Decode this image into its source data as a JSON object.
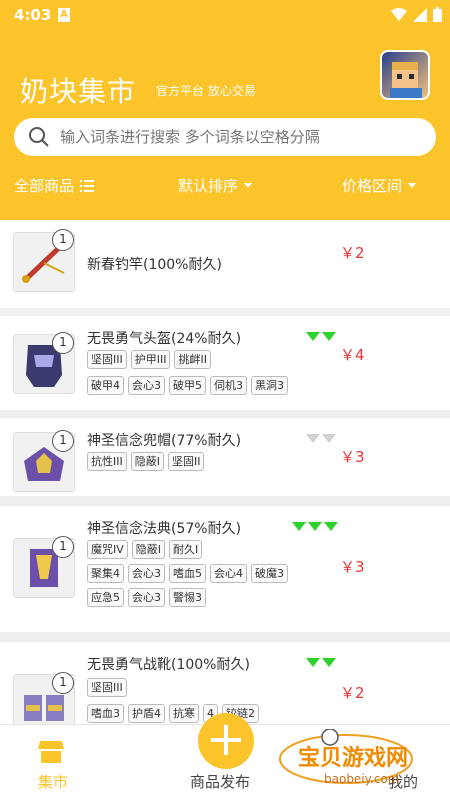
{
  "status": {
    "time": "4:03",
    "a": "A"
  },
  "header": {
    "brand": "奶块集市",
    "slogan": "官方平台 放心交易"
  },
  "search": {
    "placeholder": "输入词条进行搜索 多个词条以空格分隔"
  },
  "filters": {
    "all": "全部商品",
    "sort": "默认排序",
    "price": "价格区间"
  },
  "items": [
    {
      "title": "新春钓竿(100%耐久)",
      "price": "￥2",
      "count": "1",
      "tags": [
        []
      ],
      "gems": 0
    },
    {
      "title": "无畏勇气头盔(24%耐久)",
      "price": "￥4",
      "count": "1",
      "tags": [
        [
          "坚固III",
          "护甲III",
          "挑衅II"
        ],
        [
          "破甲4",
          "会心3",
          "破甲5",
          "伺机3",
          "黑洞3"
        ]
      ],
      "gems": 2
    },
    {
      "title": "神圣信念兜帽(77%耐久)",
      "price": "￥3",
      "count": "1",
      "tags": [
        [
          "抗性III",
          "隐蔽I",
          "坚固II"
        ]
      ],
      "gems": 2
    },
    {
      "title": "神圣信念法典(57%耐久)",
      "price": "￥3",
      "count": "1",
      "tags": [
        [
          "魔咒IV",
          "隐蔽I",
          "耐久I"
        ],
        [
          "聚集4",
          "会心3",
          "嗜血5",
          "会心4",
          "破魔3"
        ],
        [
          "应急5",
          "会心3",
          "警惕3"
        ]
      ],
      "gems": 3
    },
    {
      "title": "无畏勇气战靴(100%耐久)",
      "price": "￥2",
      "count": "1",
      "tags": [
        [
          "坚固III"
        ],
        [
          "嗜血3",
          "护盾4",
          "抗寒",
          "4",
          "铰链2"
        ]
      ],
      "gems": 2
    }
  ],
  "nav": {
    "market": "集市",
    "publish": "商品发布",
    "mine": "我的"
  },
  "watermark": {
    "title": "宝贝游戏网",
    "url": "baobeiy.com"
  },
  "colors": {
    "accent": "#fbc42b",
    "price": "#e53935",
    "gem_green": "#2fd12f"
  }
}
